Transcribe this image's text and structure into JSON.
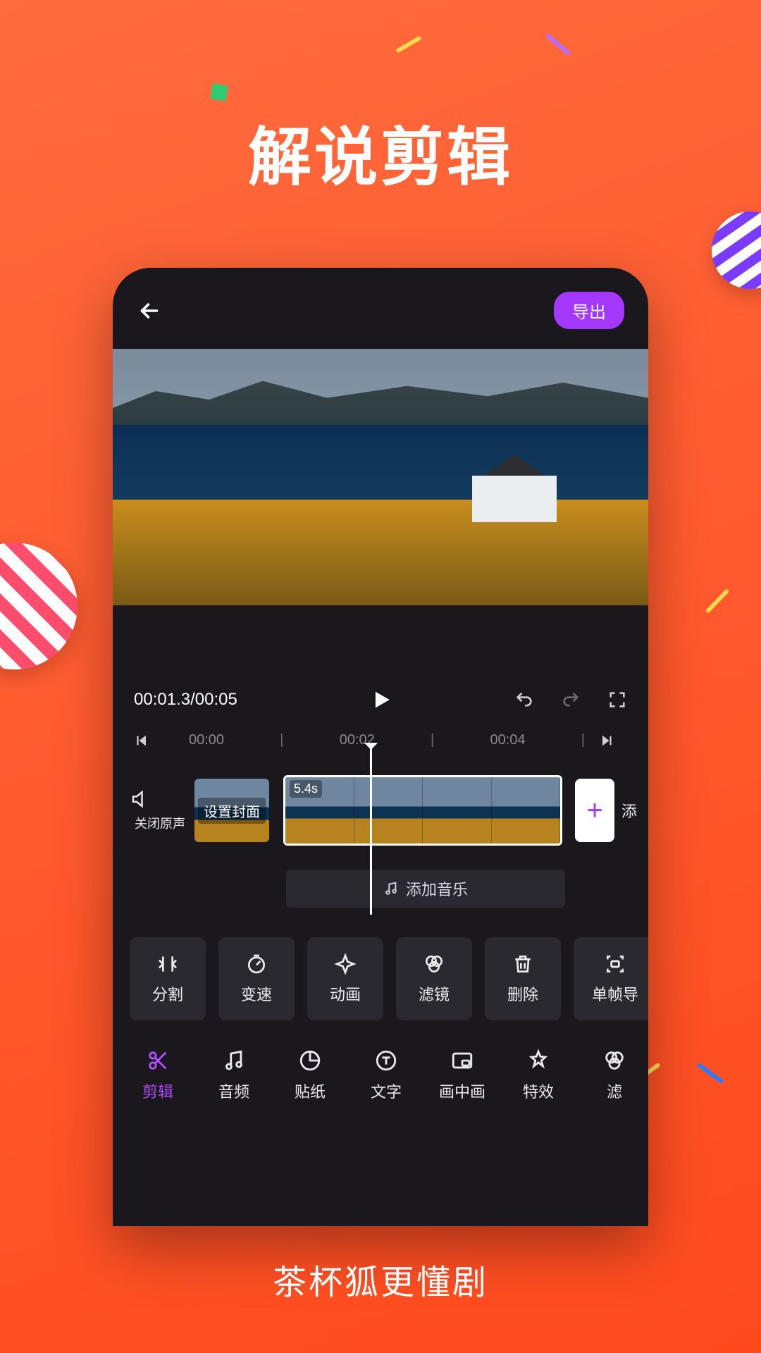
{
  "promo": {
    "headline": "解说剪辑",
    "tagline": "茶杯狐更懂剧"
  },
  "topbar": {
    "export_label": "导出"
  },
  "playback": {
    "time_text": "00:01.3/00:05"
  },
  "timeline": {
    "ticks": [
      "00:00",
      "00:02",
      "00:04"
    ],
    "mute_label": "关闭原声",
    "set_cover_label": "设置封面",
    "clip_duration": "5.4s",
    "add_track_label": "添",
    "add_music_label": "添加音乐"
  },
  "tools": [
    {
      "id": "split",
      "label": "分割"
    },
    {
      "id": "speed",
      "label": "变速"
    },
    {
      "id": "anim",
      "label": "动画"
    },
    {
      "id": "filter",
      "label": "滤镜"
    },
    {
      "id": "delete",
      "label": "删除"
    },
    {
      "id": "frame",
      "label": "单帧导"
    }
  ],
  "tabs": [
    {
      "id": "edit",
      "label": "剪辑",
      "active": true
    },
    {
      "id": "audio",
      "label": "音频",
      "active": false
    },
    {
      "id": "sticker",
      "label": "贴纸",
      "active": false
    },
    {
      "id": "text",
      "label": "文字",
      "active": false
    },
    {
      "id": "pip",
      "label": "画中画",
      "active": false
    },
    {
      "id": "fx",
      "label": "特效",
      "active": false
    },
    {
      "id": "filter2",
      "label": "滤",
      "active": false
    }
  ]
}
